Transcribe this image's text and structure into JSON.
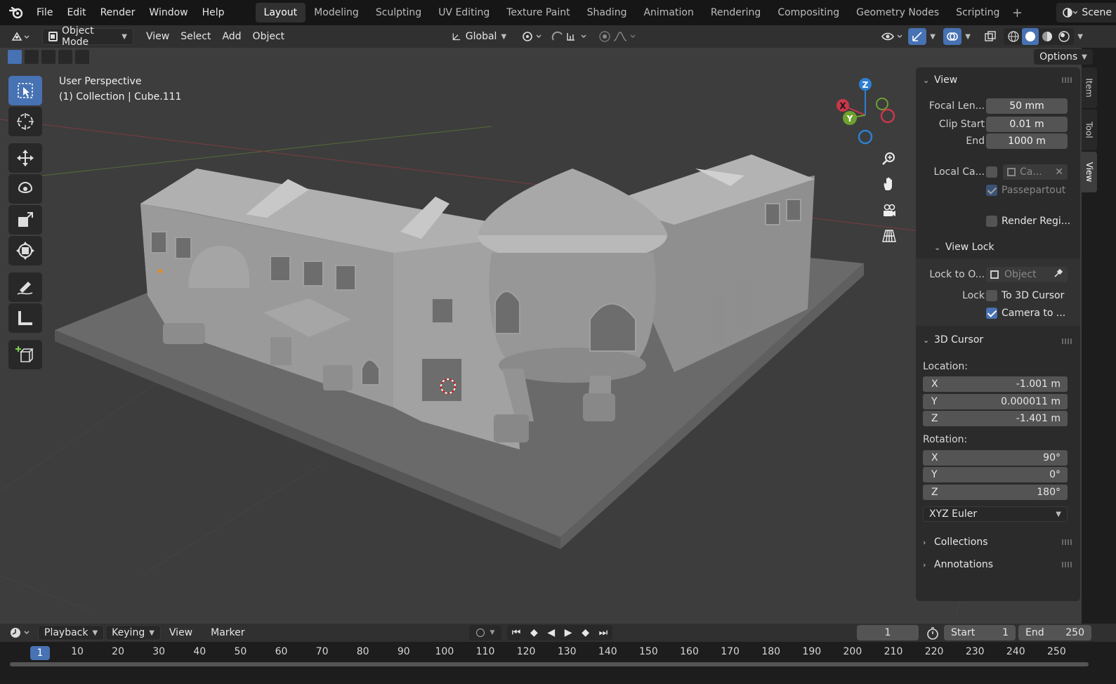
{
  "menu": {
    "items": [
      "File",
      "Edit",
      "Render",
      "Window",
      "Help"
    ]
  },
  "workspaces": {
    "tabs": [
      "Layout",
      "Modeling",
      "Sculpting",
      "UV Editing",
      "Texture Paint",
      "Shading",
      "Animation",
      "Rendering",
      "Compositing",
      "Geometry Nodes",
      "Scripting"
    ],
    "active": "Layout"
  },
  "scene": {
    "label": "Scene"
  },
  "header": {
    "mode": "Object Mode",
    "menus": [
      "View",
      "Select",
      "Add",
      "Object"
    ],
    "orientation": "Global",
    "options": "Options"
  },
  "viewport": {
    "perspective": "User Perspective",
    "collection": "(1) Collection | Cube.111"
  },
  "gizmo": {
    "x": "X",
    "y": "Y",
    "z": "Z"
  },
  "npanel": {
    "tabs": [
      "Item",
      "Tool",
      "View"
    ],
    "view": {
      "title": "View",
      "focal_label": "Focal Len...",
      "focal_value": "50 mm",
      "clip_start_label": "Clip Start",
      "clip_start_value": "0.01 m",
      "end_label": "End",
      "end_value": "1000 m",
      "local_camera_label": "Local Ca...",
      "local_camera_value": "Ca...",
      "passepartout": "Passepartout",
      "render_region": "Render Regi..."
    },
    "view_lock": {
      "title": "View Lock",
      "lock_object_label": "Lock to O...",
      "lock_object_placeholder": "Object",
      "lock_label": "Lock",
      "to_cursor": "To 3D Cursor",
      "camera_to": "Camera to ..."
    },
    "cursor": {
      "title": "3D Cursor",
      "location_label": "Location:",
      "location": [
        {
          "axis": "X",
          "value": "-1.001 m"
        },
        {
          "axis": "Y",
          "value": "0.000011 m"
        },
        {
          "axis": "Z",
          "value": "-1.401 m"
        }
      ],
      "rotation_label": "Rotation:",
      "rotation": [
        {
          "axis": "X",
          "value": "90°"
        },
        {
          "axis": "Y",
          "value": "0°"
        },
        {
          "axis": "Z",
          "value": "180°"
        }
      ],
      "rotation_mode": "XYZ Euler"
    },
    "collections": "Collections",
    "annotations": "Annotations"
  },
  "timeline": {
    "menus": [
      "Playback",
      "Keying",
      "View",
      "Marker"
    ],
    "current_frame": "1",
    "start_label": "Start",
    "start_value": "1",
    "end_label": "End",
    "end_value": "250",
    "ticks": [
      "1",
      "10",
      "20",
      "30",
      "40",
      "50",
      "60",
      "70",
      "80",
      "90",
      "100",
      "110",
      "120",
      "130",
      "140",
      "150",
      "160",
      "170",
      "180",
      "190",
      "200",
      "210",
      "220",
      "230",
      "240",
      "250"
    ]
  },
  "colors": {
    "accent": "#4772b3",
    "axis_x": "#c8374a",
    "axis_y": "#6ea12e",
    "axis_z": "#2d7fd2",
    "viewport_bg": "#3d3d3d"
  }
}
